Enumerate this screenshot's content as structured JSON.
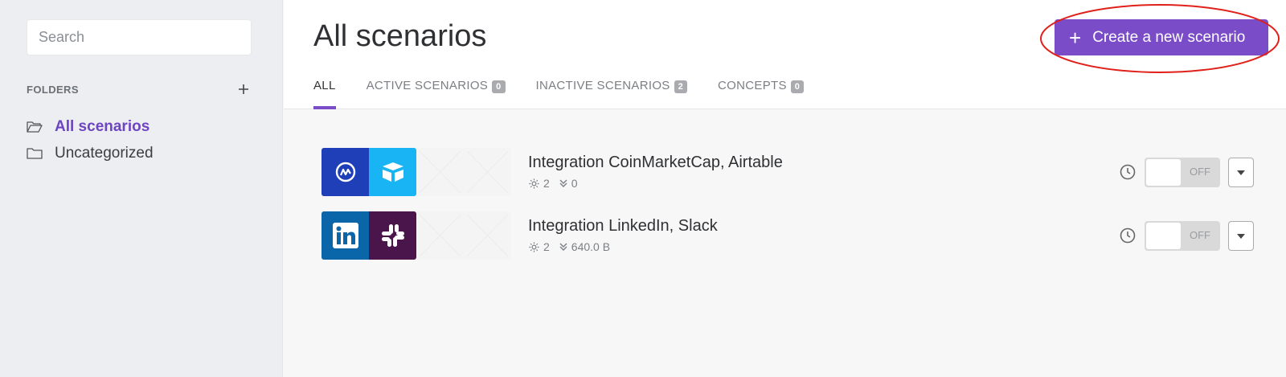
{
  "sidebar": {
    "search_placeholder": "Search",
    "folders_title": "FOLDERS",
    "folders": [
      {
        "label": "All scenarios",
        "icon": "folder-open-icon"
      },
      {
        "label": "Uncategorized",
        "icon": "folder-icon"
      }
    ]
  },
  "header": {
    "title": "All scenarios",
    "create_button": "Create a new scenario",
    "tabs": [
      {
        "label": "ALL"
      },
      {
        "label": "ACTIVE SCENARIOS",
        "count": "0"
      },
      {
        "label": "INACTIVE SCENARIOS",
        "count": "2"
      },
      {
        "label": "CONCEPTS",
        "count": "0"
      }
    ]
  },
  "scenarios": [
    {
      "name": "Integration CoinMarketCap, Airtable",
      "modules": "2",
      "transfer": "0",
      "state": "OFF",
      "apps": [
        "coinmarketcap-icon",
        "airtable-icon"
      ],
      "app_colors": [
        "#1e3fb8",
        "#18b4f4"
      ]
    },
    {
      "name": "Integration LinkedIn, Slack",
      "modules": "2",
      "transfer": "640.0 B",
      "state": "OFF",
      "apps": [
        "linkedin-icon",
        "slack-icon"
      ],
      "app_colors": [
        "#0a66a8",
        "#4a154b"
      ]
    }
  ],
  "colors": {
    "accent": "#7a4cc7",
    "highlight": "#e0201a"
  }
}
